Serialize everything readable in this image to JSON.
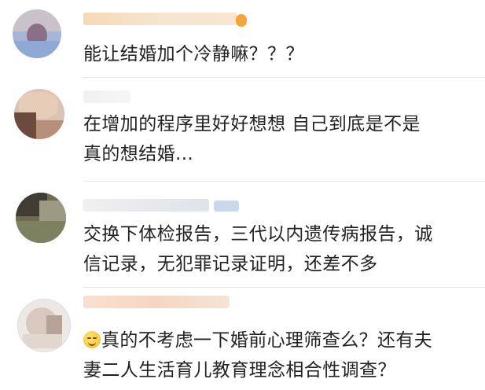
{
  "comments": [
    {
      "text_lines": [
        "能让结婚加个冷静嘛？？？"
      ],
      "avatar_icon": "blurred-user-avatar",
      "has_emoji": false
    },
    {
      "text_lines": [
        "在增加的程序里好好想想 自己到底是不是",
        "真的想结婚..."
      ],
      "avatar_icon": "blurred-user-avatar",
      "has_emoji": false
    },
    {
      "text_lines": [
        "交换下体检报告，三代以内遗传病报告，诚",
        "信记录，无犯罪记录证明，还差不多"
      ],
      "avatar_icon": "blurred-user-avatar",
      "has_emoji": false
    },
    {
      "text_lines": [
        "真的不考虑一下婚前心理筛查么？还有夫",
        "妻二人生活育儿教育理念相合性调查？"
      ],
      "avatar_icon": "blurred-user-avatar",
      "has_emoji": true,
      "emoji_icon": "grin-sweat-emoji"
    }
  ],
  "colors": {
    "text": "#222222",
    "background": "#ffffff",
    "divider": "#e8e8e8"
  }
}
